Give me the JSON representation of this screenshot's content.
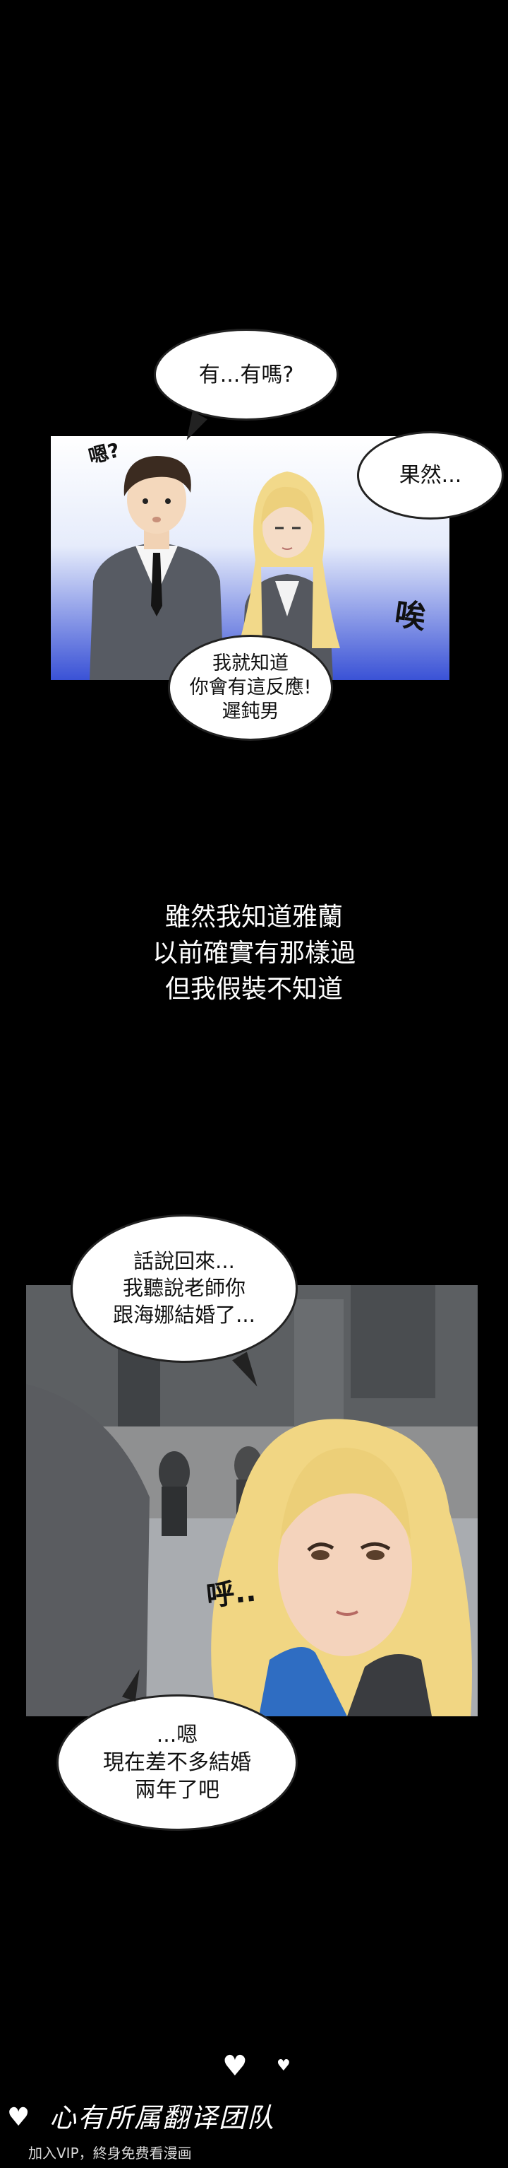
{
  "panel1": {
    "bubble_top": "有...有嗎?",
    "bubble_right": "果然...",
    "bubble_bottom": [
      "我就知道",
      "你會有這反應!",
      "遲鈍男"
    ],
    "sfx_man": "嗯?",
    "sfx_woman": "唉"
  },
  "narration": [
    "雖然我知道雅蘭",
    "以前確實有那樣過",
    "但我假裝不知道"
  ],
  "panel2": {
    "bubble_top": [
      "話說回來...",
      "我聽說老師你",
      "跟海娜結婚了..."
    ],
    "bubble_bottom": [
      "...嗯",
      "現在差不多結婚",
      "兩年了吧"
    ],
    "sfx_sigh": "呼.."
  },
  "footer": {
    "logo_text": "心有所属翻译团队",
    "watermark": "加入VIP，終身免费看漫画"
  }
}
